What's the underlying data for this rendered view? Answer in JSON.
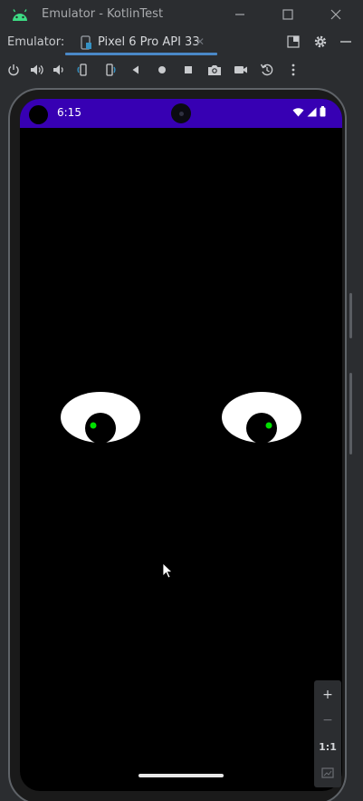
{
  "window": {
    "title": "Emulator - KotlinTest",
    "controls": {
      "minimize": "minimize",
      "maximize": "maximize",
      "close": "close"
    }
  },
  "tabbar": {
    "label": "Emulator:",
    "tab_label": "Pixel 6 Pro API 33",
    "tab_close": "✕"
  },
  "toolbar": {
    "icons": [
      "power-icon",
      "volume-up-icon",
      "volume-down-icon",
      "rotate-left-icon",
      "rotate-right-icon",
      "back-icon",
      "home-icon",
      "overview-icon",
      "screenshot-icon",
      "screen-record-icon",
      "snapshot-icon",
      "more-icon"
    ]
  },
  "device": {
    "status_time": "6:15",
    "status_bar_color": "#3700b3",
    "screen_background": "#000000",
    "pupil_highlight_color": "#00e000"
  },
  "zoom": {
    "plus": "+",
    "minus": "−",
    "one_to_one": "1:1"
  },
  "colors": {
    "accent": "#4a88c7",
    "chrome_bg": "#2b2d30"
  }
}
